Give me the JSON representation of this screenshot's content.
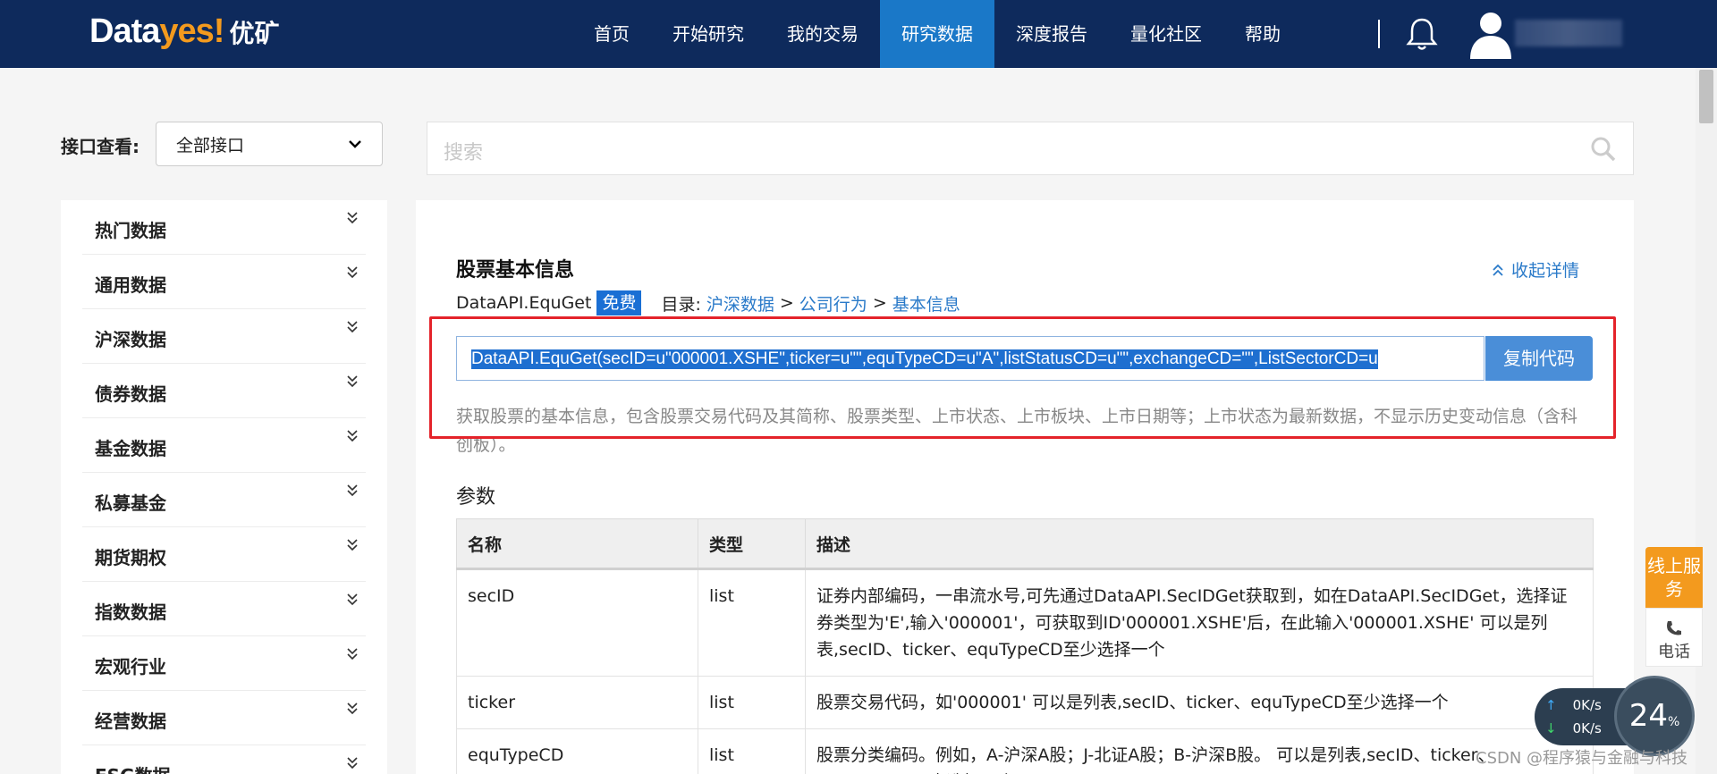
{
  "header": {
    "logo": {
      "part1": "Data",
      "part2": "yes!",
      "part3": "优矿"
    },
    "nav": [
      "首页",
      "开始研究",
      "我的交易",
      "研究数据",
      "深度报告",
      "量化社区",
      "帮助"
    ],
    "active_nav": "研究数据"
  },
  "filter": {
    "label": "接口查看:",
    "selected": "全部接口"
  },
  "search": {
    "placeholder": "搜索"
  },
  "sidebar": {
    "items": [
      "热门数据",
      "通用数据",
      "沪深数据",
      "债券数据",
      "基金数据",
      "私募基金",
      "期货期权",
      "指数数据",
      "宏观行业",
      "经营数据",
      "ESG数据"
    ]
  },
  "api": {
    "title": "股票基本信息",
    "collapse_label": "收起详情",
    "name": "DataAPI.EquGet",
    "badge": "免费",
    "catalog_label": "目录:",
    "breadcrumb": [
      "沪深数据",
      "公司行为",
      "基本信息"
    ],
    "code": "DataAPI.EquGet(secID=u\"000001.XSHE\",ticker=u\"\",equTypeCD=u\"A\",listStatusCD=u\"\",exchangeCD=\"\",ListSectorCD=u",
    "copy_label": "复制代码",
    "description": "获取股票的基本信息，包含股票交易代码及其简称、股票类型、上市状态、上市板块、上市日期等；上市状态为最新数据，不显示历史变动信息（含科创板）。"
  },
  "params": {
    "heading": "参数",
    "columns": [
      "名称",
      "类型",
      "描述"
    ],
    "rows": [
      {
        "name": "secID",
        "type": "list",
        "desc": "证券内部编码，一串流水号,可先通过DataAPI.SecIDGet获取到，如在DataAPI.SecIDGet，选择证券类型为'E',输入'000001'，可获取到ID'000001.XSHE'后，在此输入'000001.XSHE' 可以是列表,secID、ticker、equTypeCD至少选择一个"
      },
      {
        "name": "ticker",
        "type": "list",
        "desc": "股票交易代码，如'000001' 可以是列表,secID、ticker、equTypeCD至少选择一个"
      },
      {
        "name": "equTypeCD",
        "type": "list",
        "desc": "股票分类编码。例如，A-沪深A股；J-北证A股；B-沪深B股。 可以是列表,secID、ticker、equTypeCD至少选择一个"
      }
    ]
  },
  "widgets": {
    "service": "线上服务",
    "phone": "电话",
    "upload_speed": "0K/s",
    "download_speed": "0K/s",
    "gauge_value": "24",
    "gauge_unit": "%"
  },
  "watermark": "CSDN @程序猿与金融与科技"
}
